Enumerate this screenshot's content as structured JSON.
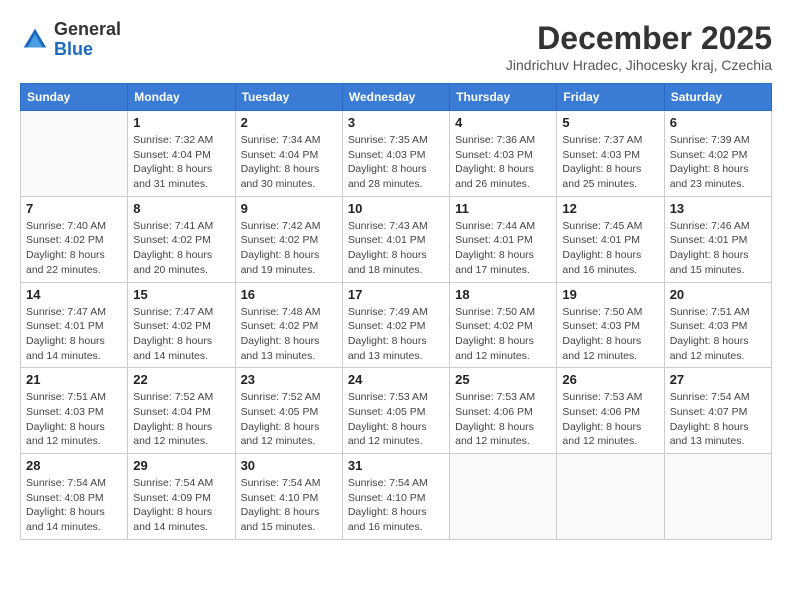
{
  "header": {
    "logo_general": "General",
    "logo_blue": "Blue",
    "month_title": "December 2025",
    "location": "Jindrichuv Hradec, Jihocesky kraj, Czechia"
  },
  "weekdays": [
    "Sunday",
    "Monday",
    "Tuesday",
    "Wednesday",
    "Thursday",
    "Friday",
    "Saturday"
  ],
  "weeks": [
    [
      {
        "day": "",
        "info": ""
      },
      {
        "day": "1",
        "info": "Sunrise: 7:32 AM\nSunset: 4:04 PM\nDaylight: 8 hours\nand 31 minutes."
      },
      {
        "day": "2",
        "info": "Sunrise: 7:34 AM\nSunset: 4:04 PM\nDaylight: 8 hours\nand 30 minutes."
      },
      {
        "day": "3",
        "info": "Sunrise: 7:35 AM\nSunset: 4:03 PM\nDaylight: 8 hours\nand 28 minutes."
      },
      {
        "day": "4",
        "info": "Sunrise: 7:36 AM\nSunset: 4:03 PM\nDaylight: 8 hours\nand 26 minutes."
      },
      {
        "day": "5",
        "info": "Sunrise: 7:37 AM\nSunset: 4:03 PM\nDaylight: 8 hours\nand 25 minutes."
      },
      {
        "day": "6",
        "info": "Sunrise: 7:39 AM\nSunset: 4:02 PM\nDaylight: 8 hours\nand 23 minutes."
      }
    ],
    [
      {
        "day": "7",
        "info": "Sunrise: 7:40 AM\nSunset: 4:02 PM\nDaylight: 8 hours\nand 22 minutes."
      },
      {
        "day": "8",
        "info": "Sunrise: 7:41 AM\nSunset: 4:02 PM\nDaylight: 8 hours\nand 20 minutes."
      },
      {
        "day": "9",
        "info": "Sunrise: 7:42 AM\nSunset: 4:02 PM\nDaylight: 8 hours\nand 19 minutes."
      },
      {
        "day": "10",
        "info": "Sunrise: 7:43 AM\nSunset: 4:01 PM\nDaylight: 8 hours\nand 18 minutes."
      },
      {
        "day": "11",
        "info": "Sunrise: 7:44 AM\nSunset: 4:01 PM\nDaylight: 8 hours\nand 17 minutes."
      },
      {
        "day": "12",
        "info": "Sunrise: 7:45 AM\nSunset: 4:01 PM\nDaylight: 8 hours\nand 16 minutes."
      },
      {
        "day": "13",
        "info": "Sunrise: 7:46 AM\nSunset: 4:01 PM\nDaylight: 8 hours\nand 15 minutes."
      }
    ],
    [
      {
        "day": "14",
        "info": "Sunrise: 7:47 AM\nSunset: 4:01 PM\nDaylight: 8 hours\nand 14 minutes."
      },
      {
        "day": "15",
        "info": "Sunrise: 7:47 AM\nSunset: 4:02 PM\nDaylight: 8 hours\nand 14 minutes."
      },
      {
        "day": "16",
        "info": "Sunrise: 7:48 AM\nSunset: 4:02 PM\nDaylight: 8 hours\nand 13 minutes."
      },
      {
        "day": "17",
        "info": "Sunrise: 7:49 AM\nSunset: 4:02 PM\nDaylight: 8 hours\nand 13 minutes."
      },
      {
        "day": "18",
        "info": "Sunrise: 7:50 AM\nSunset: 4:02 PM\nDaylight: 8 hours\nand 12 minutes."
      },
      {
        "day": "19",
        "info": "Sunrise: 7:50 AM\nSunset: 4:03 PM\nDaylight: 8 hours\nand 12 minutes."
      },
      {
        "day": "20",
        "info": "Sunrise: 7:51 AM\nSunset: 4:03 PM\nDaylight: 8 hours\nand 12 minutes."
      }
    ],
    [
      {
        "day": "21",
        "info": "Sunrise: 7:51 AM\nSunset: 4:03 PM\nDaylight: 8 hours\nand 12 minutes."
      },
      {
        "day": "22",
        "info": "Sunrise: 7:52 AM\nSunset: 4:04 PM\nDaylight: 8 hours\nand 12 minutes."
      },
      {
        "day": "23",
        "info": "Sunrise: 7:52 AM\nSunset: 4:05 PM\nDaylight: 8 hours\nand 12 minutes."
      },
      {
        "day": "24",
        "info": "Sunrise: 7:53 AM\nSunset: 4:05 PM\nDaylight: 8 hours\nand 12 minutes."
      },
      {
        "day": "25",
        "info": "Sunrise: 7:53 AM\nSunset: 4:06 PM\nDaylight: 8 hours\nand 12 minutes."
      },
      {
        "day": "26",
        "info": "Sunrise: 7:53 AM\nSunset: 4:06 PM\nDaylight: 8 hours\nand 12 minutes."
      },
      {
        "day": "27",
        "info": "Sunrise: 7:54 AM\nSunset: 4:07 PM\nDaylight: 8 hours\nand 13 minutes."
      }
    ],
    [
      {
        "day": "28",
        "info": "Sunrise: 7:54 AM\nSunset: 4:08 PM\nDaylight: 8 hours\nand 14 minutes."
      },
      {
        "day": "29",
        "info": "Sunrise: 7:54 AM\nSunset: 4:09 PM\nDaylight: 8 hours\nand 14 minutes."
      },
      {
        "day": "30",
        "info": "Sunrise: 7:54 AM\nSunset: 4:10 PM\nDaylight: 8 hours\nand 15 minutes."
      },
      {
        "day": "31",
        "info": "Sunrise: 7:54 AM\nSunset: 4:10 PM\nDaylight: 8 hours\nand 16 minutes."
      },
      {
        "day": "",
        "info": ""
      },
      {
        "day": "",
        "info": ""
      },
      {
        "day": "",
        "info": ""
      }
    ]
  ]
}
